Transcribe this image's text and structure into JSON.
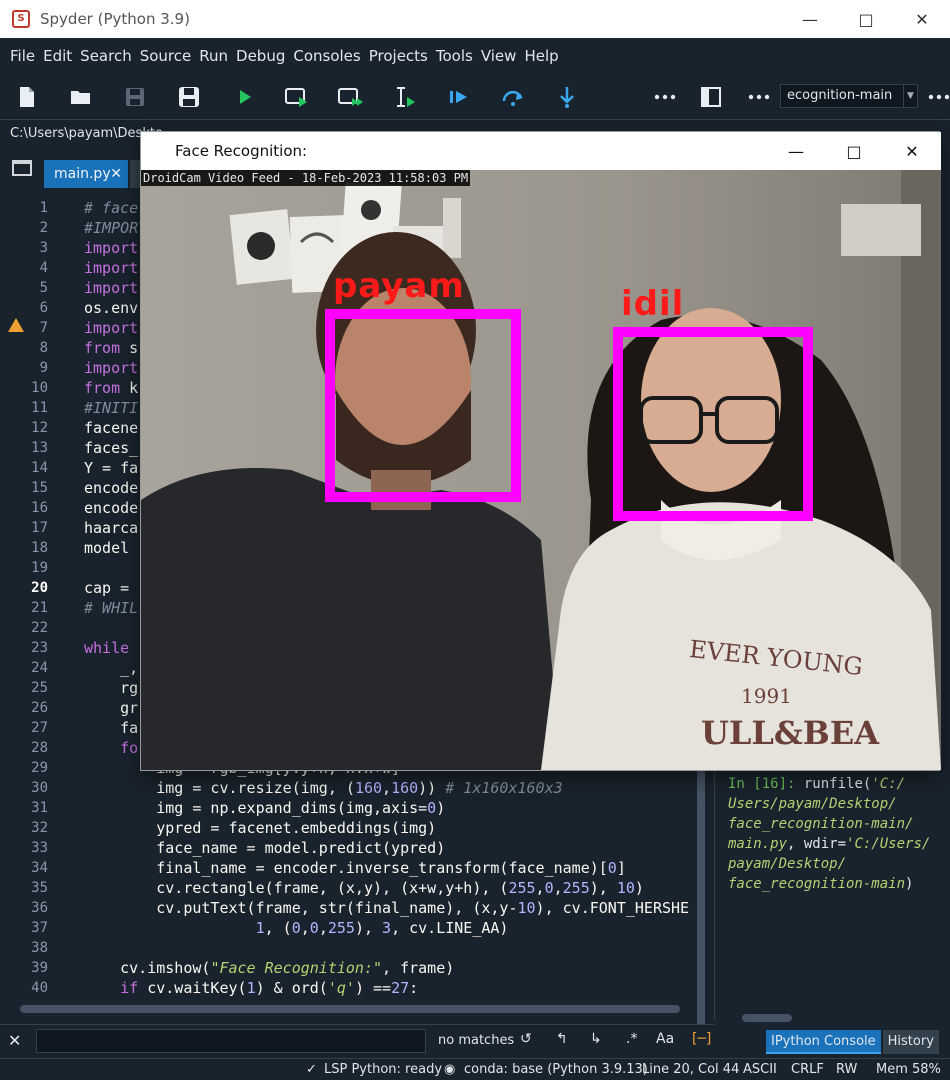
{
  "app": {
    "title": "Spyder (Python 3.9)",
    "menu": [
      "File",
      "Edit",
      "Search",
      "Source",
      "Run",
      "Debug",
      "Consoles",
      "Projects",
      "Tools",
      "View",
      "Help"
    ],
    "project_combo": "ecognition-main",
    "path": "C:\\Users\\payam\\Deskto",
    "tab_name": "main.py"
  },
  "colors": {
    "background": "#19232d",
    "accent": "#1a72bb",
    "toolbar_icon_blue": "#3aa8f0",
    "run_green": "#22c55e",
    "box_magenta": "#ff00ff",
    "label_red": "#ff1a1a"
  },
  "editor": {
    "current_line": 20,
    "lines": [
      {
        "n": 1,
        "html": "<span class='c'># face</span>"
      },
      {
        "n": 2,
        "html": "<span class='c'>#IMPORT</span>"
      },
      {
        "n": 3,
        "html": "<span class='k'>import</span>"
      },
      {
        "n": 4,
        "html": "<span class='k'>import</span>"
      },
      {
        "n": 5,
        "html": "<span class='k'>import</span>"
      },
      {
        "n": 6,
        "html": "os.env"
      },
      {
        "n": 7,
        "html": "<span class='k'>import</span>"
      },
      {
        "n": 8,
        "html": "<span class='k'>from</span> s"
      },
      {
        "n": 9,
        "html": "<span class='k'>import</span>"
      },
      {
        "n": 10,
        "html": "<span class='k'>from</span> k"
      },
      {
        "n": 11,
        "html": "<span class='c'>#INITI</span>"
      },
      {
        "n": 12,
        "html": "facene"
      },
      {
        "n": 13,
        "html": "faces_"
      },
      {
        "n": 14,
        "html": "Y = fa"
      },
      {
        "n": 15,
        "html": "encode"
      },
      {
        "n": 16,
        "html": "encode"
      },
      {
        "n": 17,
        "html": "haarca"
      },
      {
        "n": 18,
        "html": "model "
      },
      {
        "n": 19,
        "html": ""
      },
      {
        "n": 20,
        "html": "cap = "
      },
      {
        "n": 21,
        "html": "<span class='c'># WHIL</span>"
      },
      {
        "n": 22,
        "html": ""
      },
      {
        "n": 23,
        "html": "<span class='k'>while</span> "
      },
      {
        "n": 24,
        "html": "    _,"
      },
      {
        "n": 25,
        "html": "    rg"
      },
      {
        "n": 26,
        "html": "    gr"
      },
      {
        "n": 27,
        "html": "    fa"
      },
      {
        "n": 28,
        "html": "    <span class='k'>fo</span>"
      },
      {
        "n": 29,
        "html": "        img = rgb_img[y:y+h, x:x+w]"
      },
      {
        "n": 30,
        "html": "        img = cv.resize(img, (<span class='n'>160</span>,<span class='n'>160</span>)) <span class='c'># 1x160x160x3</span>"
      },
      {
        "n": 31,
        "html": "        img = np.expand_dims(img,axis=<span class='n'>0</span>)"
      },
      {
        "n": 32,
        "html": "        ypred = facenet.embeddings(img)"
      },
      {
        "n": 33,
        "html": "        face_name = model.predict(ypred)"
      },
      {
        "n": 34,
        "html": "        final_name = encoder.inverse_transform(face_name)[<span class='n'>0</span>]"
      },
      {
        "n": 35,
        "html": "        cv.rectangle(frame, (x,y), (x+w,y+h), (<span class='n'>255</span>,<span class='n'>0</span>,<span class='n'>255</span>), <span class='n'>10</span>)"
      },
      {
        "n": 36,
        "html": "        cv.putText(frame, str(final_name), (x,y-<span class='n'>10</span>), cv.FONT_HERSHE"
      },
      {
        "n": 37,
        "html": "                   <span class='n'>1</span>, (<span class='n'>0</span>,<span class='n'>0</span>,<span class='n'>255</span>), <span class='n'>3</span>, cv.LINE_AA)"
      },
      {
        "n": 38,
        "html": ""
      },
      {
        "n": 39,
        "html": "    cv.imshow(<span class='s'>\"Face Recognition:\"</span>, frame)"
      },
      {
        "n": 40,
        "html": "    <span class='k'>if</span> cv.waitKey(<span class='n'>1</span>) &amp; ord(<span class='s'>'q'</span>) ==<span class='n'>27</span>:"
      }
    ]
  },
  "find": {
    "message": "no matches"
  },
  "console": {
    "prompt": "In [16]:",
    "lines": [
      "Users/payam/Desktop/",
      "face_recognition-main/",
      "main.py",
      "payam/Desktop/",
      "face_recognition-main"
    ],
    "cmd": "runfile(",
    "arg1": "'C:/",
    "wdir": ", wdir=",
    "arg2": "'C:/Users/",
    "close": ")"
  },
  "console_tabs": [
    "IPython Console",
    "History"
  ],
  "status": {
    "lsp": "LSP Python: ready",
    "conda": "conda: base (Python 3.9.13)",
    "position": "Line 20, Col 44",
    "encoding": "ASCII",
    "eol": "CRLF",
    "rw": "RW",
    "mem": "Mem 58%"
  },
  "face_window": {
    "title": "Face Recognition:",
    "overlay": "DroidCam Video Feed - 18-Feb-2023 11:58:03 PM",
    "faces": [
      {
        "label": "payam"
      },
      {
        "label": "idil"
      }
    ],
    "shirt_text_1": "EVER YOUNG",
    "shirt_text_2": "1991",
    "shirt_text_3": "ULL&BEA"
  }
}
